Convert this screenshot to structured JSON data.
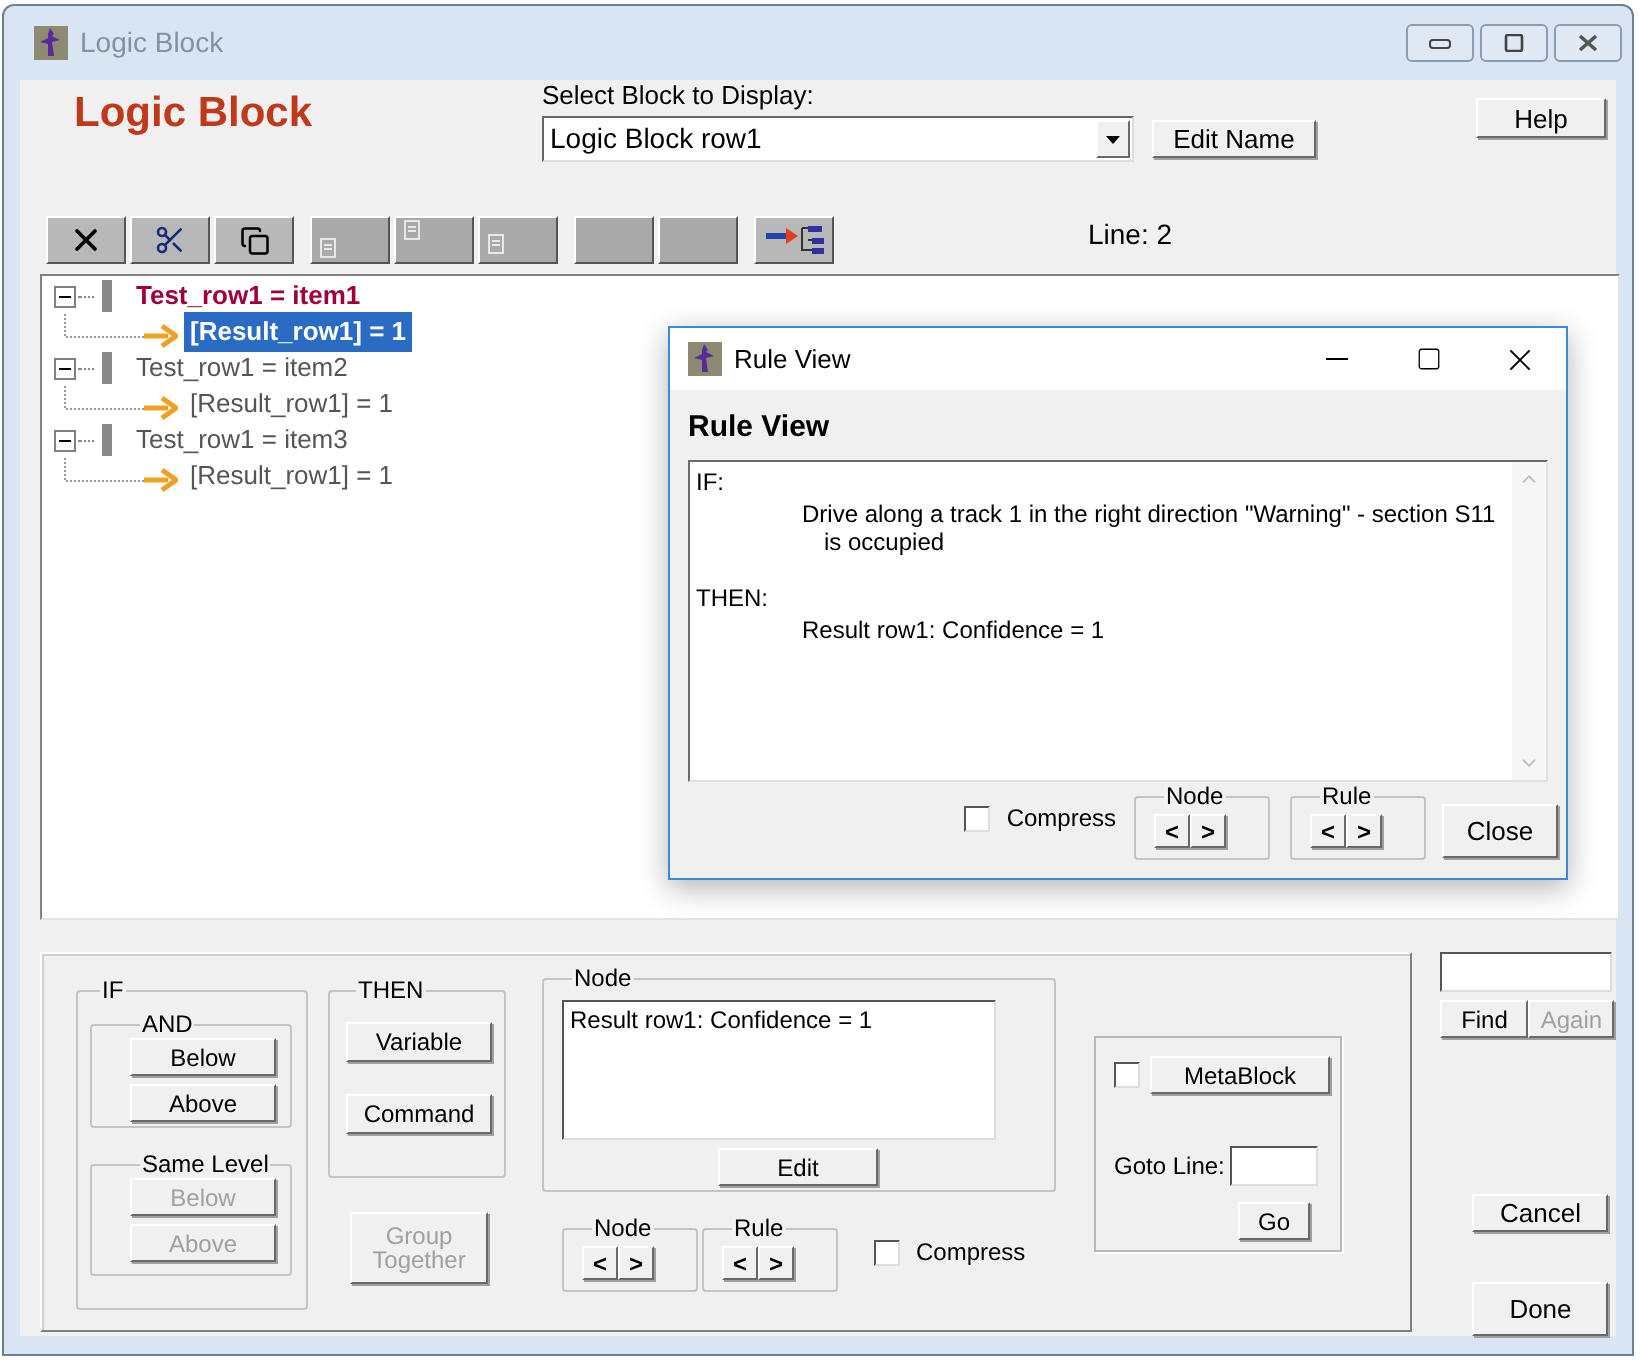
{
  "window": {
    "title": "Logic Block"
  },
  "header": {
    "title": "Logic Block",
    "select_label": "Select Block to Display:",
    "select_value": "Logic Block row1",
    "edit_name_button": "Edit Name",
    "help_button": "Help",
    "line_label": "Line: 2"
  },
  "toolbar": [
    [
      {
        "kind": "delete",
        "disabled": false
      },
      {
        "kind": "cut",
        "disabled": false
      },
      {
        "kind": "copy",
        "disabled": false
      }
    ],
    [
      {
        "kind": "page-top",
        "disabled": true
      },
      {
        "kind": "page-middle",
        "disabled": true
      },
      {
        "kind": "page-bottom",
        "disabled": true
      }
    ],
    [
      {
        "kind": "blank",
        "disabled": true
      },
      {
        "kind": "blank",
        "disabled": true
      }
    ],
    [
      {
        "kind": "move",
        "disabled": false
      }
    ]
  ],
  "tree": [
    {
      "label": "Test_row1 = item1",
      "active": true,
      "expanded": true,
      "children": [
        {
          "label": "[Result_row1] = 1",
          "selected": true
        }
      ]
    },
    {
      "label": "Test_row1 = item2",
      "active": false,
      "expanded": true,
      "children": [
        {
          "label": "[Result_row1] = 1",
          "selected": false
        }
      ]
    },
    {
      "label": "Test_row1 = item3",
      "active": false,
      "expanded": true,
      "children": [
        {
          "label": "[Result_row1] = 1",
          "selected": false
        }
      ]
    }
  ],
  "rule_view": {
    "title": "Rule View",
    "heading": "Rule View",
    "sections": [
      {
        "keyword": "IF:",
        "body": [
          "Drive along a track 1 in the right direction \"Warning\" - section S11",
          "is occupied"
        ]
      },
      {
        "keyword": "THEN:",
        "body": [
          "Result row1: Confidence = 1"
        ]
      }
    ],
    "compress": {
      "label": "Compress",
      "checked": false
    },
    "node_nav": {
      "label": "Node",
      "prev": "<",
      "next": ">"
    },
    "rule_nav": {
      "label": "Rule",
      "prev": "<",
      "next": ">"
    },
    "close_button": "Close"
  },
  "bottom": {
    "if_group": {
      "label": "IF",
      "and": {
        "label": "AND",
        "buttons": [
          {
            "label": "Below",
            "disabled": false
          },
          {
            "label": "Above",
            "disabled": false
          }
        ]
      },
      "same_level": {
        "label": "Same Level",
        "buttons": [
          {
            "label": "Below",
            "disabled": true
          },
          {
            "label": "Above",
            "disabled": true
          }
        ]
      }
    },
    "then_group": {
      "label": "THEN",
      "buttons": [
        {
          "label": "Variable",
          "disabled": false
        },
        {
          "label": "Command",
          "disabled": false
        }
      ]
    },
    "group_together": {
      "label": "Group Together",
      "disabled": true
    },
    "node_group": {
      "label": "Node",
      "text": "Result row1: Confidence = 1",
      "edit_button": "Edit"
    },
    "node_nav": {
      "label": "Node",
      "prev": "<",
      "next": ">"
    },
    "rule_nav": {
      "label": "Rule",
      "prev": "<",
      "next": ">"
    },
    "compress": {
      "label": "Compress",
      "checked": false
    },
    "metablock": {
      "checked": false,
      "button": "MetaBlock",
      "goto_label": "Goto Line:",
      "go_button": "Go"
    },
    "find": {
      "button": "Find",
      "again": {
        "label": "Again",
        "disabled": true
      }
    },
    "cancel_button": "Cancel",
    "done_button": "Done"
  }
}
